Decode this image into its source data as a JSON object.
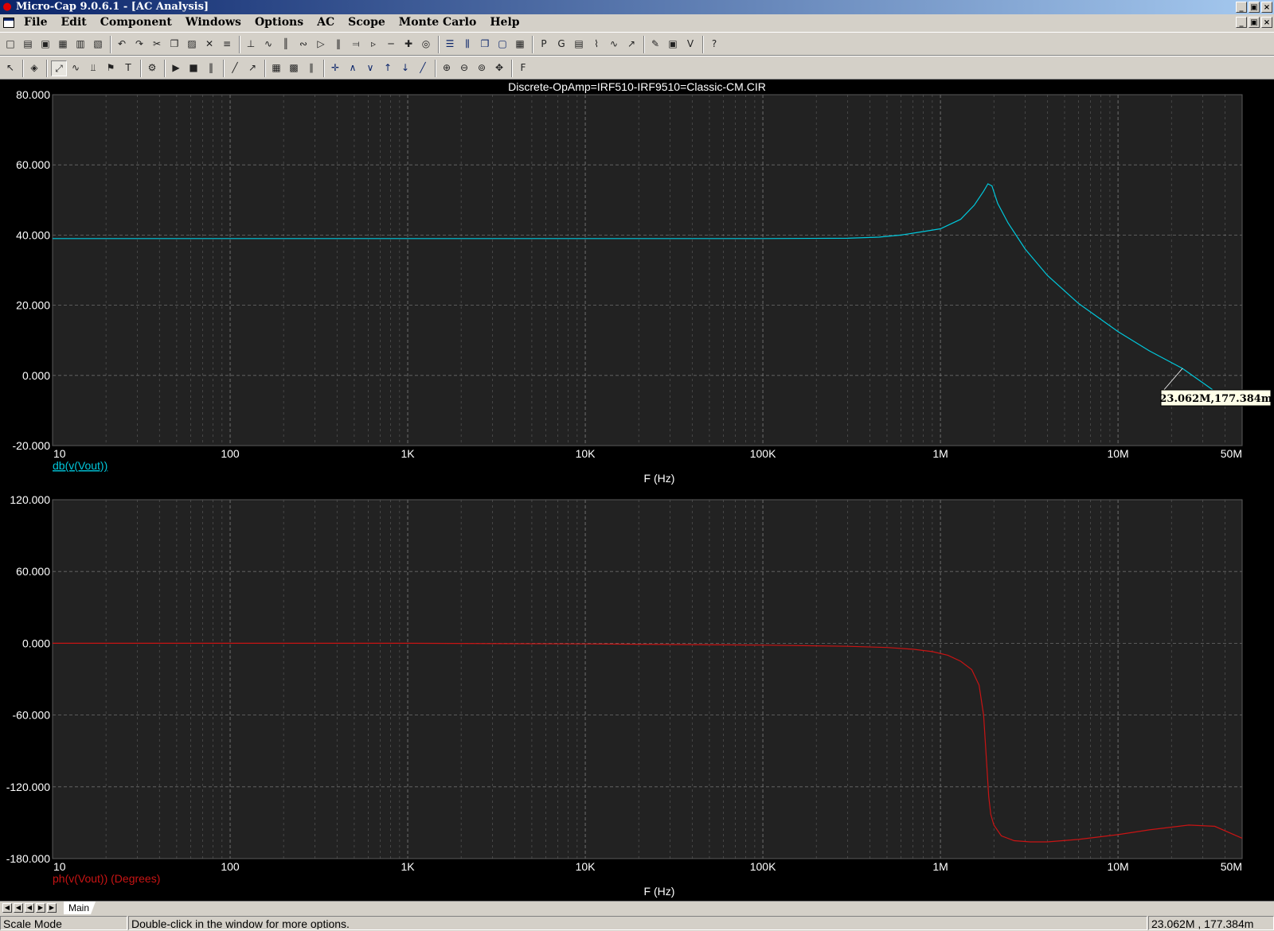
{
  "window": {
    "title": "Micro-Cap 9.0.6.1 - [AC Analysis]"
  },
  "menu": [
    "File",
    "Edit",
    "Component",
    "Windows",
    "Options",
    "AC",
    "Scope",
    "Monte Carlo",
    "Help"
  ],
  "toolbar1": [
    "new-icon",
    "open-icon",
    "save-icon",
    "save-all-icon",
    "print-icon",
    "print-preview-icon",
    "undo-icon",
    "redo-icon",
    "cut-icon",
    "copy-icon",
    "paste-icon",
    "delete-icon",
    "select-all-icon",
    "ground-icon",
    "resistor-icon",
    "capacitor-icon",
    "inductor-icon",
    "diode-icon",
    "battery-icon",
    "transistor-icon",
    "opamp-icon",
    "wire-icon",
    "junction-icon",
    "source-icon",
    "tile-horizontal-icon",
    "tile-vertical-icon",
    "cascade-icon",
    "window-icon",
    "calculator-icon",
    "p-key-icon",
    "g-key-icon",
    "table-icon",
    "bode-icon",
    "wave-icon",
    "probe-icon",
    "pen-icon",
    "scope-icon",
    "variables-icon",
    "help-icon"
  ],
  "toolbar2": [
    "pointer-icon",
    "component-icon",
    "scale-icon",
    "graph-icon",
    "axis-icon",
    "tag-icon",
    "text-icon",
    "properties-icon",
    "run-icon",
    "stop-icon",
    "pause-icon",
    "line-icon",
    "diagonal-icon",
    "grid-icon",
    "minor-grid-icon",
    "bars-icon",
    "cursor-icon",
    "peak-icon",
    "valley-icon",
    "high-icon",
    "low-icon",
    "slope-icon",
    "zoom-in-icon",
    "zoom-out-icon",
    "zoom-fit-icon",
    "pan-icon",
    "f-key-icon"
  ],
  "plot": {
    "title": "Discrete-OpAmp=IRF510-IRF9510=Classic-CM.CIR",
    "cursor_label": "23.062M,177.384m",
    "colors": {
      "background": "#222222",
      "grid": "#808080",
      "axis_text": "#ffffff",
      "mag_trace": "#00c8dc",
      "phase_trace": "#c81414"
    }
  },
  "chart_data": [
    {
      "type": "line",
      "xlabel": "F (Hz)",
      "ylabel": "",
      "x_scale": "log",
      "xlim": [
        10,
        50000000
      ],
      "ylim": [
        -20,
        80
      ],
      "x_tick_labels": [
        "10",
        "100",
        "1K",
        "10K",
        "100K",
        "1M",
        "10M",
        "50M"
      ],
      "y_tick_labels": [
        "80.000",
        "60.000",
        "40.000",
        "20.000",
        "0.000",
        "-20.000"
      ],
      "grid": true,
      "series": [
        {
          "name": "db(v(Vout))",
          "x": [
            10,
            100,
            1000,
            10000,
            100000,
            300000,
            450000,
            600000,
            800000,
            1000000,
            1300000,
            1550000,
            1750000,
            1850000,
            1950000,
            2100000,
            2400000,
            3000000,
            4000000,
            6000000,
            10000000,
            15000000,
            23062000,
            35000000
          ],
          "y": [
            39,
            39,
            39,
            39,
            39,
            39.1,
            39.4,
            40,
            41,
            41.8,
            44.5,
            48.5,
            52.5,
            54.6,
            54,
            49,
            43.5,
            36,
            28.5,
            20.5,
            12.5,
            7,
            2,
            -4.5
          ]
        }
      ]
    },
    {
      "type": "line",
      "xlabel": "F (Hz)",
      "ylabel": "",
      "x_scale": "log",
      "xlim": [
        10,
        50000000
      ],
      "ylim": [
        -180,
        120
      ],
      "x_tick_labels": [
        "10",
        "100",
        "1K",
        "10K",
        "100K",
        "1M",
        "10M",
        "50M"
      ],
      "y_tick_labels": [
        "120.000",
        "60.000",
        "0.000",
        "-60.000",
        "-120.000",
        "-180.000"
      ],
      "grid": true,
      "series": [
        {
          "name": "ph(v(Vout)) (Degrees)",
          "x": [
            10,
            100,
            1000,
            10000,
            100000,
            300000,
            500000,
            700000,
            900000,
            1100000,
            1300000,
            1500000,
            1650000,
            1750000,
            1820000,
            1870000,
            1920000,
            2000000,
            2200000,
            2600000,
            3200000,
            4000000,
            6000000,
            10000000,
            15000000,
            25000000,
            35000000,
            50000000
          ],
          "y": [
            0,
            0,
            0,
            -0.5,
            -1.5,
            -2.5,
            -3.5,
            -5,
            -7,
            -10,
            -15,
            -22,
            -35,
            -60,
            -100,
            -128,
            -143,
            -152,
            -161,
            -165,
            -166,
            -166,
            -164,
            -160,
            -156,
            -152,
            -153,
            -163
          ]
        }
      ]
    }
  ],
  "tabs": {
    "active": "Main"
  },
  "status": {
    "mode": "Scale Mode",
    "hint": "Double-click in the window for more options.",
    "cursor": "23.062M , 177.384m"
  }
}
